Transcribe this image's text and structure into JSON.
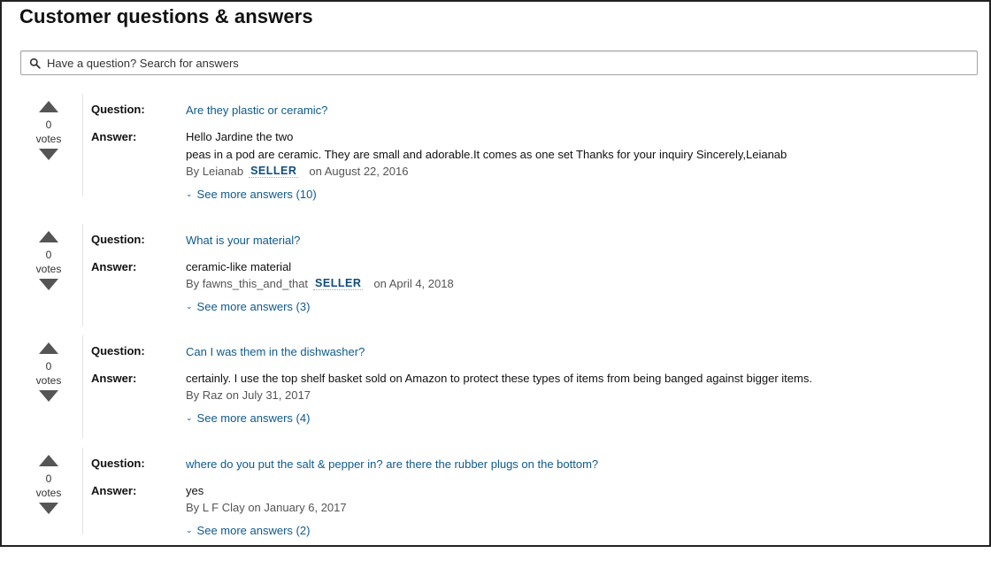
{
  "section": {
    "title": "Customer questions & answers"
  },
  "search": {
    "placeholder": "Have a question? Search for answers"
  },
  "labels": {
    "question": "Question:",
    "answer": "Answer:",
    "votes": "votes",
    "seller": "SELLER"
  },
  "items": [
    {
      "votes": "0",
      "question": "Are they plastic or ceramic?",
      "answer_lines": [
        "Hello Jardine the two",
        "peas in a pod are ceramic. They are small and adorable.It comes as one set Thanks for your inquiry Sincerely,Leianab"
      ],
      "by": "By Leianab",
      "date": "on August 22, 2016",
      "more": "See more answers (10)"
    },
    {
      "votes": "0",
      "question": "What is your material?",
      "answer_lines": [
        "ceramic-like material"
      ],
      "by": "By fawns_this_and_that",
      "date": "on April 4, 2018",
      "more": "See more answers (3)"
    },
    {
      "votes": "0",
      "question": "Can I was them in the dishwasher?",
      "answer_lines": [
        "certainly. I use the top shelf basket sold on Amazon to protect these types of items from being banged against bigger items."
      ],
      "byline": "By Raz on July 31, 2017",
      "more": "See more answers (4)"
    },
    {
      "votes": "0",
      "question": "where do you put the salt & pepper in? are there the rubber plugs on the bottom?",
      "answer_lines": [
        "yes"
      ],
      "byline": "By L F Clay on January 6, 2017",
      "more": "See more answers (2)"
    }
  ]
}
